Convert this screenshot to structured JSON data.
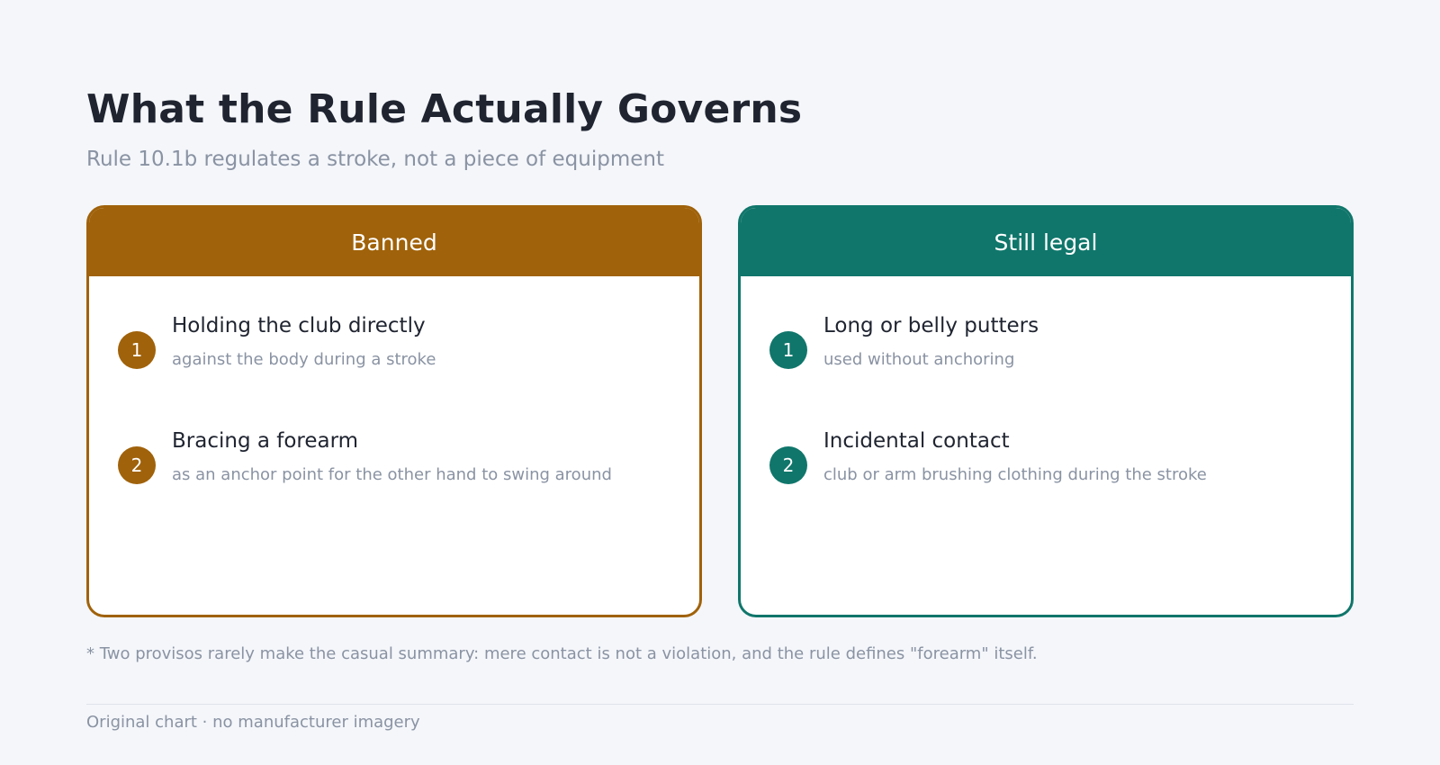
{
  "title": "What the Rule Actually Governs",
  "subtitle": "Rule 10.1b regulates a stroke, not a piece of equipment",
  "panels": [
    {
      "heading": "Banned",
      "color": "#a0620a",
      "items": [
        {
          "number": "1",
          "title": "Holding the club directly",
          "detail": "against the body during a stroke"
        },
        {
          "number": "2",
          "title": "Bracing a forearm",
          "detail": "as an anchor point for the other hand to swing around"
        }
      ]
    },
    {
      "heading": "Still legal",
      "color": "#10766b",
      "items": [
        {
          "number": "1",
          "title": "Long or belly putters",
          "detail": "used without anchoring"
        },
        {
          "number": "2",
          "title": "Incidental contact",
          "detail": "club or arm brushing clothing during the stroke"
        }
      ]
    }
  ],
  "footnote": "* Two provisos rarely make the casual summary: mere contact is not a violation, and the rule defines \"forearm\" itself.",
  "source": "Original chart · no manufacturer imagery"
}
